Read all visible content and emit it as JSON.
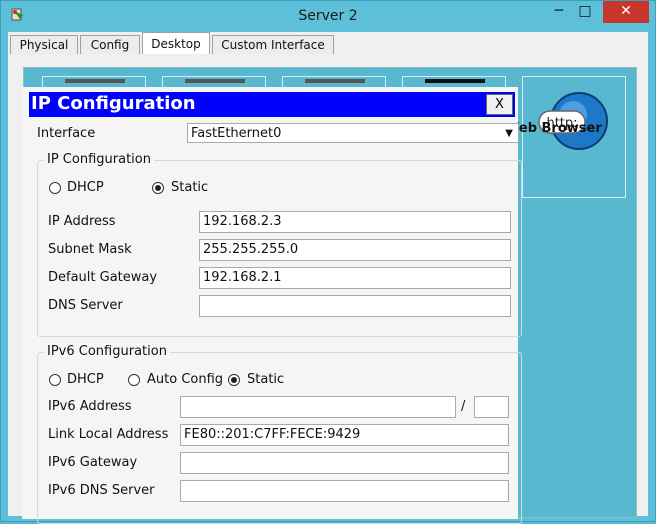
{
  "window": {
    "title": "Server 2",
    "minimize": "─",
    "maximize": "□",
    "close": "✕"
  },
  "tabs": [
    {
      "label": "Physical",
      "active": false
    },
    {
      "label": "Config",
      "active": false
    },
    {
      "label": "Desktop",
      "active": true
    },
    {
      "label": "Custom Interface",
      "active": false
    }
  ],
  "desktop": {
    "web_browser_label": "Web Browser",
    "http_icon_text": "http:"
  },
  "dialog": {
    "title": "IP Configuration",
    "close_label": "X",
    "interface_label": "Interface",
    "interface_value": "FastEthernet0",
    "ipv4": {
      "group_title": "IP Configuration",
      "dhcp_label": "DHCP",
      "static_label": "Static",
      "selected": "Static",
      "ip_address_label": "IP Address",
      "ip_address": "192.168.2.3",
      "subnet_mask_label": "Subnet Mask",
      "subnet_mask": "255.255.255.0",
      "gateway_label": "Default Gateway",
      "gateway": "192.168.2.1",
      "dns_label": "DNS Server",
      "dns": ""
    },
    "ipv6": {
      "group_title": "IPv6 Configuration",
      "dhcp_label": "DHCP",
      "auto_label": "Auto Config",
      "static_label": "Static",
      "selected": "Static",
      "address_label": "IPv6 Address",
      "address": "",
      "prefix_sep": "/",
      "prefix": "",
      "link_local_label": "Link Local Address",
      "link_local": "FE80::201:C7FF:FECE:9429",
      "gateway_label": "IPv6 Gateway",
      "gateway": "",
      "dns_label": "IPv6 DNS Server",
      "dns": ""
    }
  }
}
